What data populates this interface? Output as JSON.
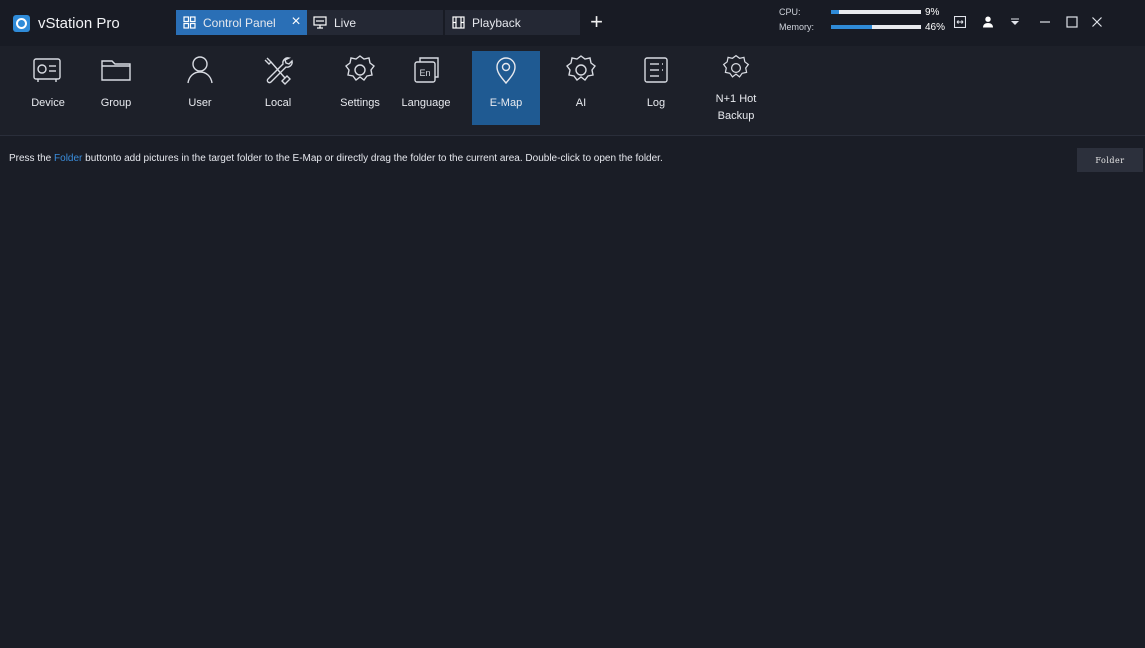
{
  "app": {
    "title": "vStation Pro"
  },
  "tabs": [
    {
      "label": "Control Panel",
      "icon": "grid-icon",
      "active": true,
      "closable": true
    },
    {
      "label": "Live",
      "icon": "monitor-icon",
      "active": false
    },
    {
      "label": "Playback",
      "icon": "film-icon",
      "active": false
    }
  ],
  "add_tab_label": "+",
  "system": {
    "cpu": {
      "label": "CPU:",
      "value": "9%",
      "fraction": 0.09
    },
    "memory": {
      "label": "Memory:",
      "value": "46%",
      "fraction": 0.46
    }
  },
  "nav": [
    {
      "label": "Device",
      "icon": "device-icon"
    },
    {
      "label": "Group",
      "icon": "folder-icon"
    },
    {
      "label": "User",
      "icon": "user-icon"
    },
    {
      "label": "Local",
      "icon": "tools-icon"
    },
    {
      "label": "Settings",
      "icon": "gear-icon"
    },
    {
      "label": "Language",
      "icon": "language-icon"
    },
    {
      "label": "E-Map",
      "icon": "map-pin-icon",
      "active": true
    },
    {
      "label": "AI",
      "icon": "ai-gear-icon"
    },
    {
      "label": "Log",
      "icon": "log-icon"
    },
    {
      "label": "N+1 Hot Backup",
      "icon": "backup-gear-icon"
    }
  ],
  "emap": {
    "hint_prefix": "Press the ",
    "hint_link": "Folder",
    "hint_suffix": " buttonto add pictures in the target folder to the E-Map or directly drag the folder to the current area. Double-click to open the folder.",
    "folder_button": "Folder"
  },
  "colors": {
    "accent": "#2f8bd8",
    "active_tab": "#2a6fb6",
    "active_nav": "#1f5a92",
    "background": "#1a1d26",
    "link": "#3a8ddc"
  }
}
